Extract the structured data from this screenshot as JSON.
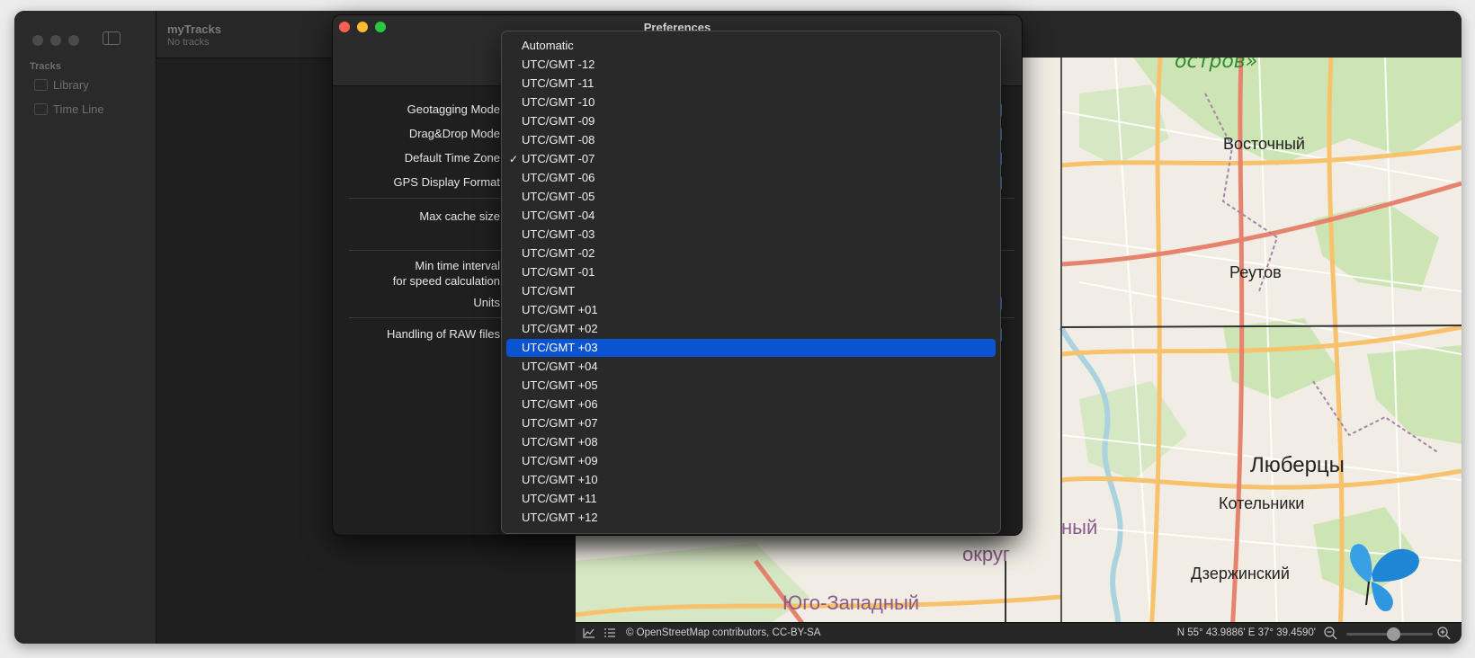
{
  "main_window": {
    "app_title": "myTracks",
    "app_subtitle": "No tracks",
    "sidebar": {
      "section": "Tracks",
      "items": [
        {
          "label": "Library",
          "icon": "folder-icon"
        },
        {
          "label": "Time Line",
          "icon": "calendar-icon"
        }
      ]
    }
  },
  "map": {
    "labels": {
      "ostrov": "остров»",
      "vostochny": "Восточный",
      "reutov": "Реутов",
      "lyubertsy": "Люберцы",
      "kotelniki": "Котельники",
      "dzerzhinsky": "Дзержинский",
      "yugo": "Юго-Западный",
      "okrug": "округ",
      "ny": "ный"
    },
    "colors": {
      "land": "#f1ede4",
      "green": "#cde5b4",
      "road_major": "#f7c26b",
      "road_red": "#e6836e",
      "water": "#aad3df"
    }
  },
  "map_status": {
    "attribution": "© OpenStreetMap contributors, CC-BY-SA",
    "coordinates": "N 55° 43.9886' E 37° 39.4590'",
    "zoom_level": 0.55
  },
  "preferences": {
    "title": "Preferences",
    "labels": {
      "geotagging_mode": "Geotagging Mode",
      "drag_drop_mode": "Drag&Drop Mode",
      "default_time_zone": "Default Time Zone",
      "gps_display_format": "GPS Display Format",
      "max_cache_size": "Max cache size",
      "min_time_interval_1": "Min time interval",
      "min_time_interval_2": "for speed calculation",
      "units": "Units",
      "handling_raw": "Handling of RAW files"
    }
  },
  "timezone_menu": {
    "checked": "UTC/GMT -07",
    "highlighted": "UTC/GMT +03",
    "items": [
      "Automatic",
      "UTC/GMT -12",
      "UTC/GMT -11",
      "UTC/GMT -10",
      "UTC/GMT -09",
      "UTC/GMT -08",
      "UTC/GMT -07",
      "UTC/GMT -06",
      "UTC/GMT -05",
      "UTC/GMT -04",
      "UTC/GMT -03",
      "UTC/GMT -02",
      "UTC/GMT -01",
      "UTC/GMT",
      "UTC/GMT +01",
      "UTC/GMT +02",
      "UTC/GMT +03",
      "UTC/GMT +04",
      "UTC/GMT +05",
      "UTC/GMT +06",
      "UTC/GMT +07",
      "UTC/GMT +08",
      "UTC/GMT +09",
      "UTC/GMT +10",
      "UTC/GMT +11",
      "UTC/GMT +12"
    ]
  }
}
